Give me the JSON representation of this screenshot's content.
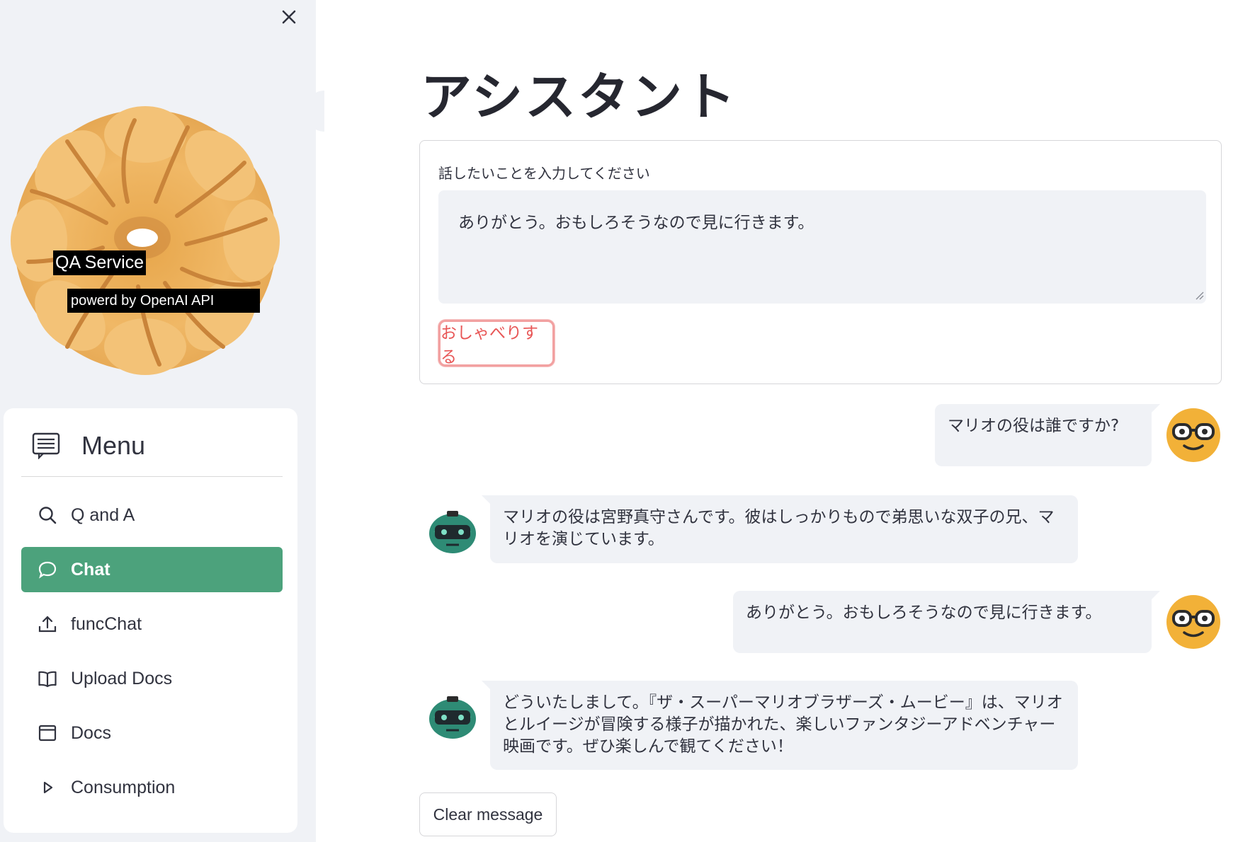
{
  "sidebar": {
    "logo": {
      "title": "QA Service",
      "subtitle": "powerd by OpenAI API"
    },
    "menu": {
      "title": "Menu",
      "items": [
        {
          "label": "Q and A",
          "icon": "search-icon",
          "active": false
        },
        {
          "label": "Chat",
          "icon": "chat-bubble-icon",
          "active": true
        },
        {
          "label": "funcChat",
          "icon": "upload-icon",
          "active": false
        },
        {
          "label": "Upload Docs",
          "icon": "book-icon",
          "active": false
        },
        {
          "label": "Docs",
          "icon": "window-icon",
          "active": false
        },
        {
          "label": "Consumption",
          "icon": "play-triangle-icon",
          "active": false
        }
      ]
    }
  },
  "main": {
    "title": "アシスタント",
    "form": {
      "label": "話したいことを入力してください",
      "input_value": "ありがとう。おもしろそうなので見に行きます。",
      "submit_label": "おしゃべりする"
    },
    "messages": [
      {
        "role": "user",
        "text": "マリオの役は誰ですか?"
      },
      {
        "role": "assistant",
        "text": "マリオの役は宮野真守さんです。彼はしっかりもので弟思いな双子の兄、マリオを演じています。"
      },
      {
        "role": "user",
        "text": "ありがとう。おもしろそうなので見に行きます。"
      },
      {
        "role": "assistant",
        "text": "どういたしまして。『ザ・スーパーマリオブラザーズ・ムービー』は、マリオとルイージが冒険する様子が描かれた、楽しいファンタジーアドベンチャー映画です。ぜひ楽しんで観てください！"
      }
    ],
    "clear_label": "Clear message"
  },
  "colors": {
    "accent": "#4ca27c",
    "sidebar_bg": "#f0f2f6",
    "submit_text": "#e85656",
    "submit_border": "#f2a1a1",
    "bubble_bg": "#f0f2f6",
    "user_avatar": "#f2b138",
    "bot_avatar": "#2e8b75"
  }
}
